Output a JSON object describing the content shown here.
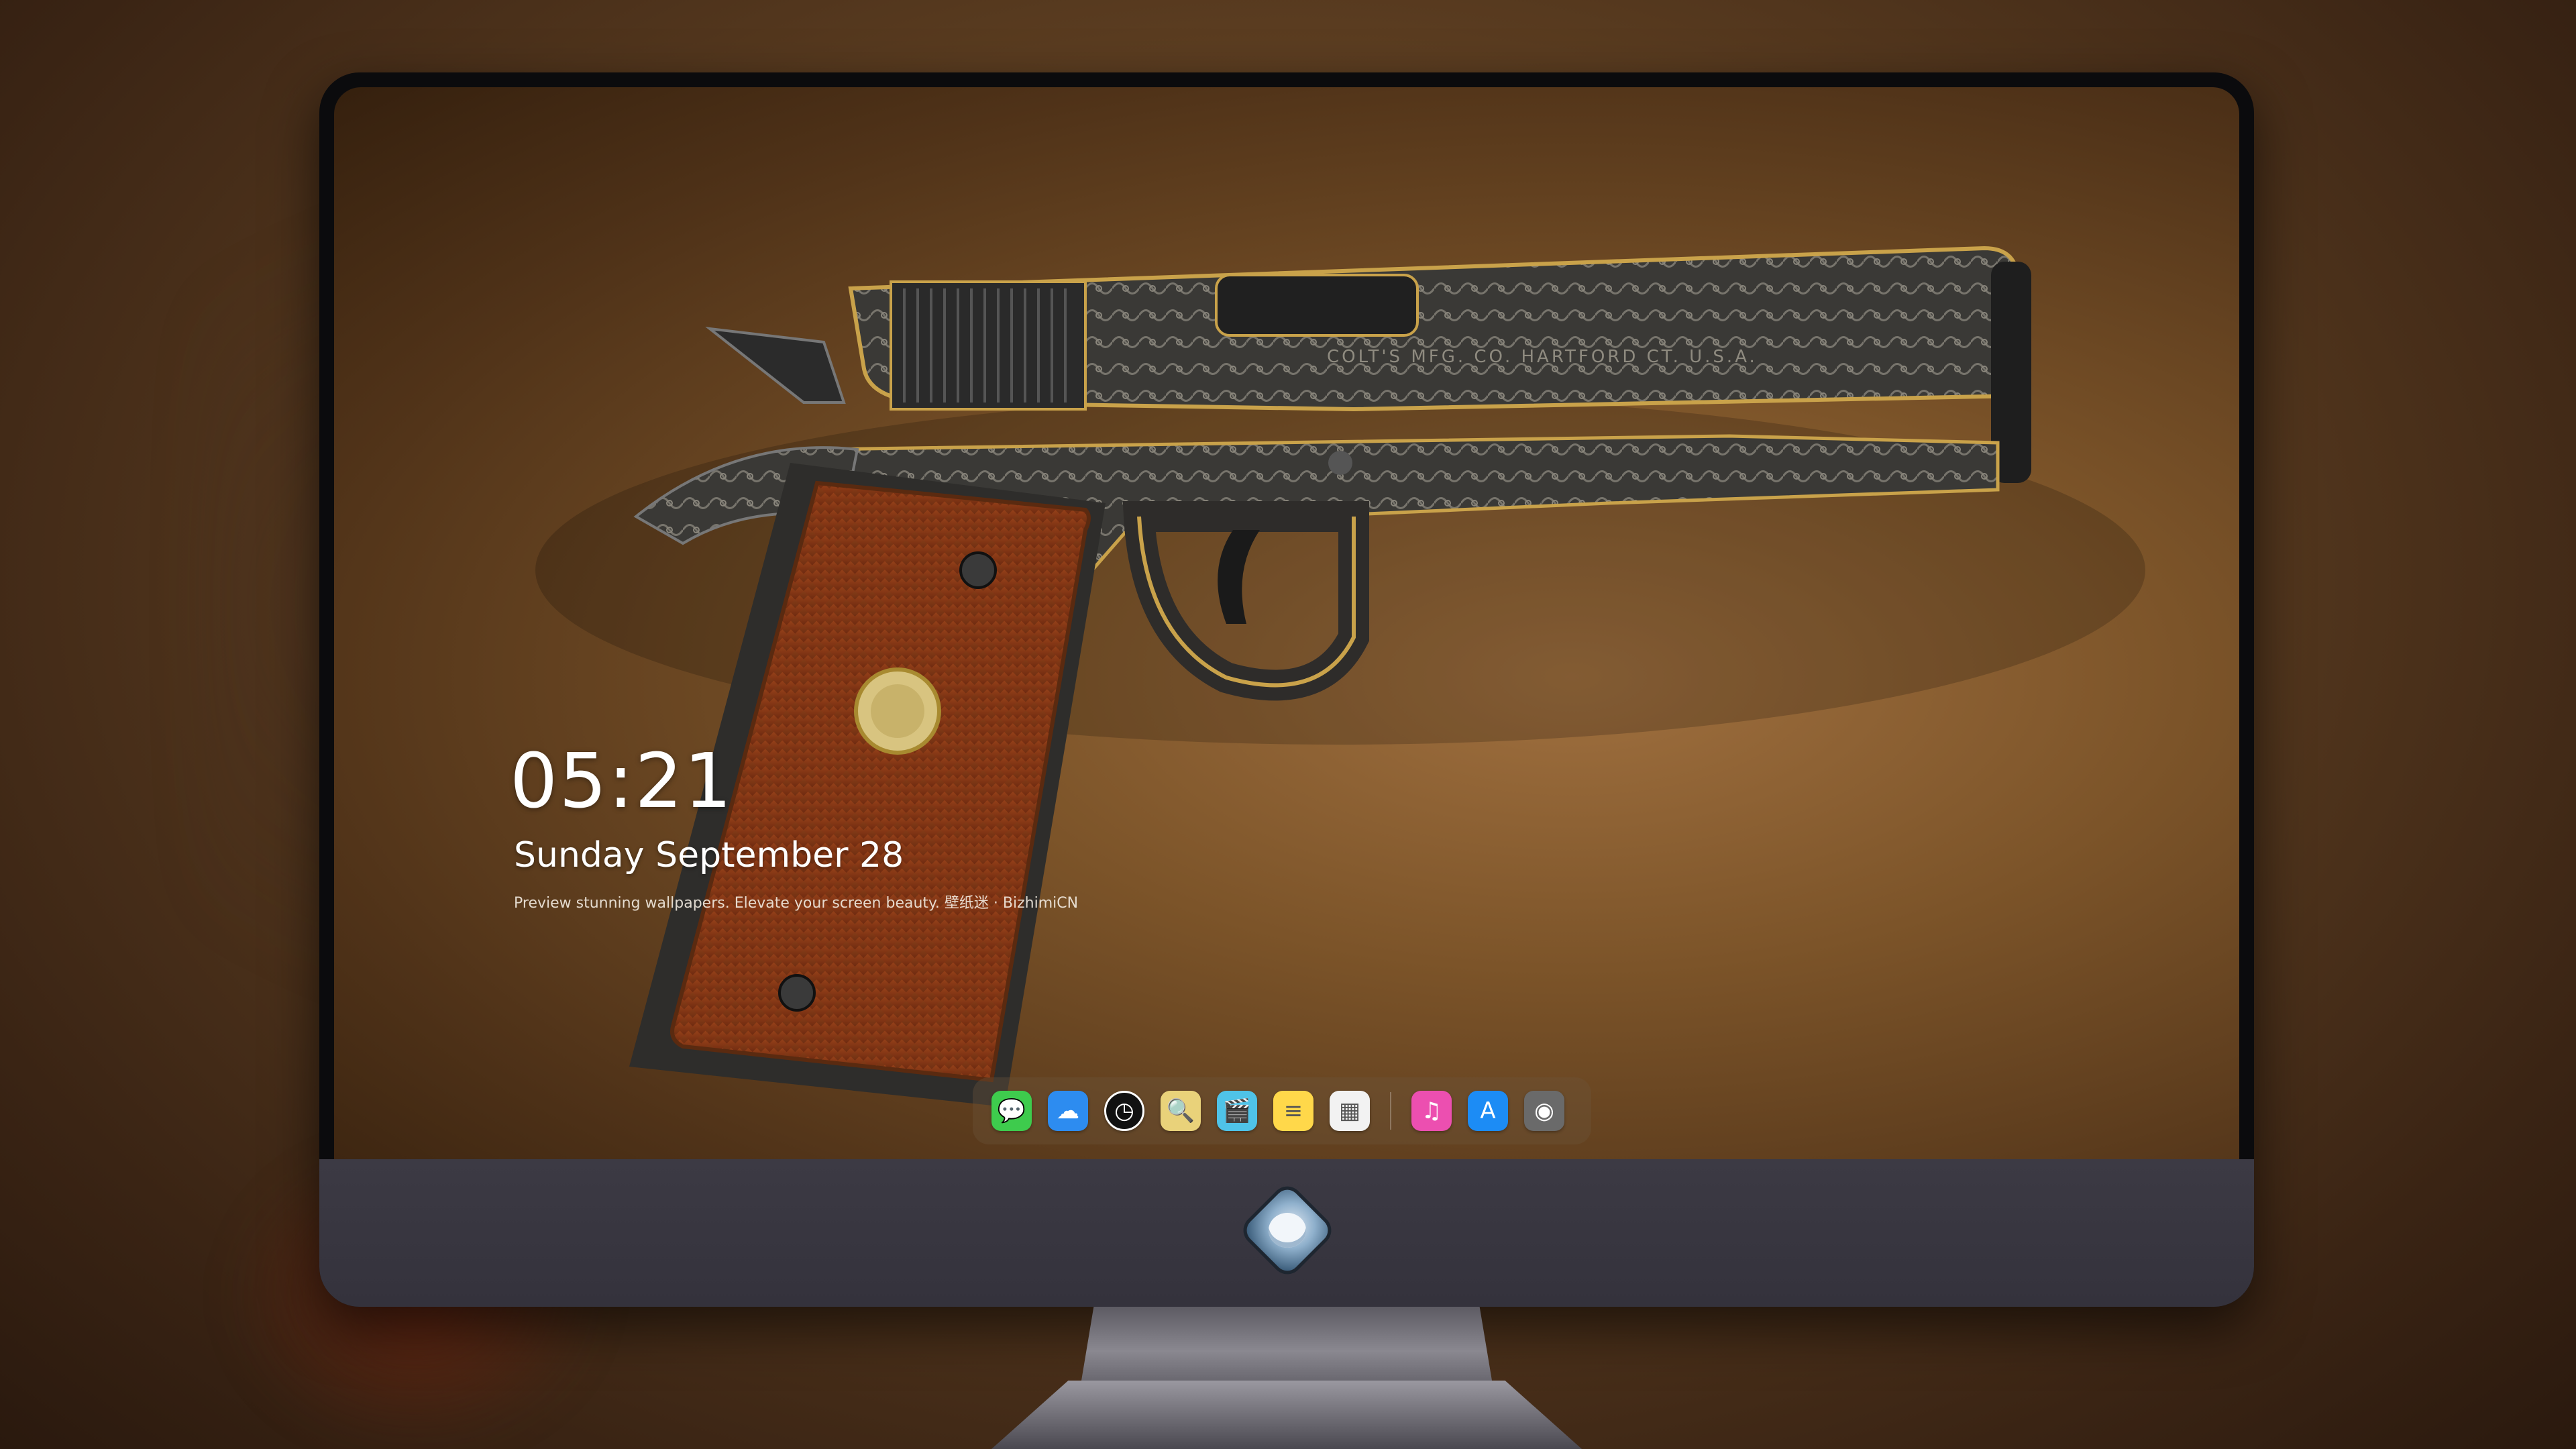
{
  "lockscreen": {
    "time": "05:21",
    "date": "Sunday September  28",
    "tagline": "Preview stunning wallpapers. Elevate your screen beauty. 壁纸迷 · BizhimiCN"
  },
  "pistol": {
    "slide_engraving": "COLT'S MFG. CO. HARTFORD CT. U.S.A."
  },
  "dock": {
    "apps": [
      {
        "name": "messages-icon",
        "glyph": "💬",
        "color": "#3ecb4d"
      },
      {
        "name": "weather-icon",
        "glyph": "☁",
        "color": "#2d8cf0"
      },
      {
        "name": "clock-icon",
        "glyph": "◷",
        "color": "#111111"
      },
      {
        "name": "preview-icon",
        "glyph": "🔍",
        "color": "#e9d27a"
      },
      {
        "name": "clips-icon",
        "glyph": "🎬",
        "color": "#4fc3e8"
      },
      {
        "name": "notes-icon",
        "glyph": "≡",
        "color": "#ffd84a"
      },
      {
        "name": "photos-icon",
        "glyph": "▦",
        "color": "#f2f2f2"
      },
      {
        "name": "music-icon",
        "glyph": "♫",
        "color": "#ec4fb0"
      },
      {
        "name": "app-store-icon",
        "glyph": "A",
        "color": "#1c8cf5"
      },
      {
        "name": "camera-icon",
        "glyph": "◉",
        "color": "#6a6a6a"
      }
    ]
  },
  "colors": {
    "screen_bg": "#7c5429",
    "grip": "#8a3a18",
    "steel": "#3a3a3a",
    "brass_trim": "#c9a24a",
    "monitor_chin": "#3c3a44"
  }
}
